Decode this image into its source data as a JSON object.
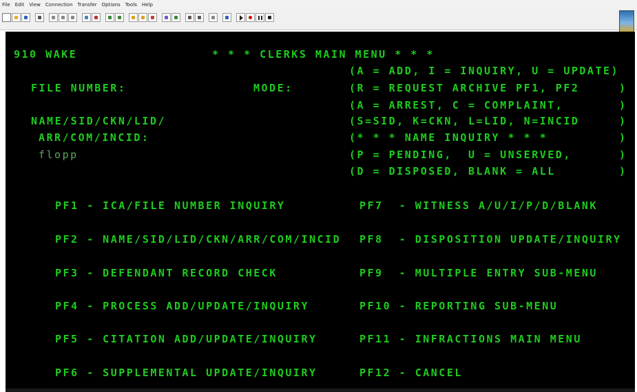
{
  "menu": [
    "File",
    "Edit",
    "View",
    "Connection",
    "Transfer",
    "Options",
    "Tools",
    "Help"
  ],
  "toolbar_icons": [
    "new-icon",
    "open-icon",
    "save-icon",
    "print-icon",
    "cut-icon",
    "copy-icon",
    "paste-icon",
    "find-icon",
    "connect-icon",
    "disconnect-icon",
    "send-icon",
    "receive-icon",
    "transfer-icon",
    "macro-icon",
    "settings-icon",
    "options-icon",
    "keyboard-icon",
    "display-icon",
    "help-icon",
    "about-icon",
    "play-icon",
    "record-icon",
    "pause-icon",
    "stop-icon"
  ],
  "screen": {
    "region": "910 WAKE",
    "title": "* * * CLERKS MAIN MENU * * *",
    "file_number_label": "FILE NUMBER:",
    "mode_label": "MODE:",
    "mode_help": [
      "(A = ADD, I = INQUIRY, U = UPDATE)",
      "(R = REQUEST ARCHIVE PF1, PF2     )",
      "(A = ARREST, C = COMPLAINT,       )"
    ],
    "name_label_1": "NAME/SID/CKN/LID/",
    "name_label_2": "ARR/COM/INCID:",
    "name_value": "flopp",
    "name_help": [
      "(S=SID, K=CKN, L=LID, N=INCID     )",
      "(* * * NAME INQUIRY * * *         )",
      "(P = PENDING,  U = UNSERVED,      )",
      "(D = DISPOSED, BLANK = ALL        )"
    ],
    "pf_left": [
      "PF1 - ICA/FILE NUMBER INQUIRY",
      "PF2 - NAME/SID/LID/CKN/ARR/COM/INCID",
      "PF3 - DEFENDANT RECORD CHECK",
      "PF4 - PROCESS ADD/UPDATE/INQUIRY",
      "PF5 - CITATION ADD/UPDATE/INQUIRY",
      "PF6 - SUPPLEMENTAL UPDATE/INQUIRY"
    ],
    "pf_right": [
      "PF7  - WITNESS A/U/I/P/D/BLANK",
      "PF8  - DISPOSITION UPDATE/INQUIRY",
      "PF9  - MULTIPLE ENTRY SUB-MENU",
      "PF10 - REPORTING SUB-MENU",
      "PF11 - INFRACTIONS MAIN MENU",
      "PF12 - CANCEL"
    ]
  },
  "colors": {
    "terminal_bg": "#000000",
    "terminal_text": "#1ecc1e"
  }
}
